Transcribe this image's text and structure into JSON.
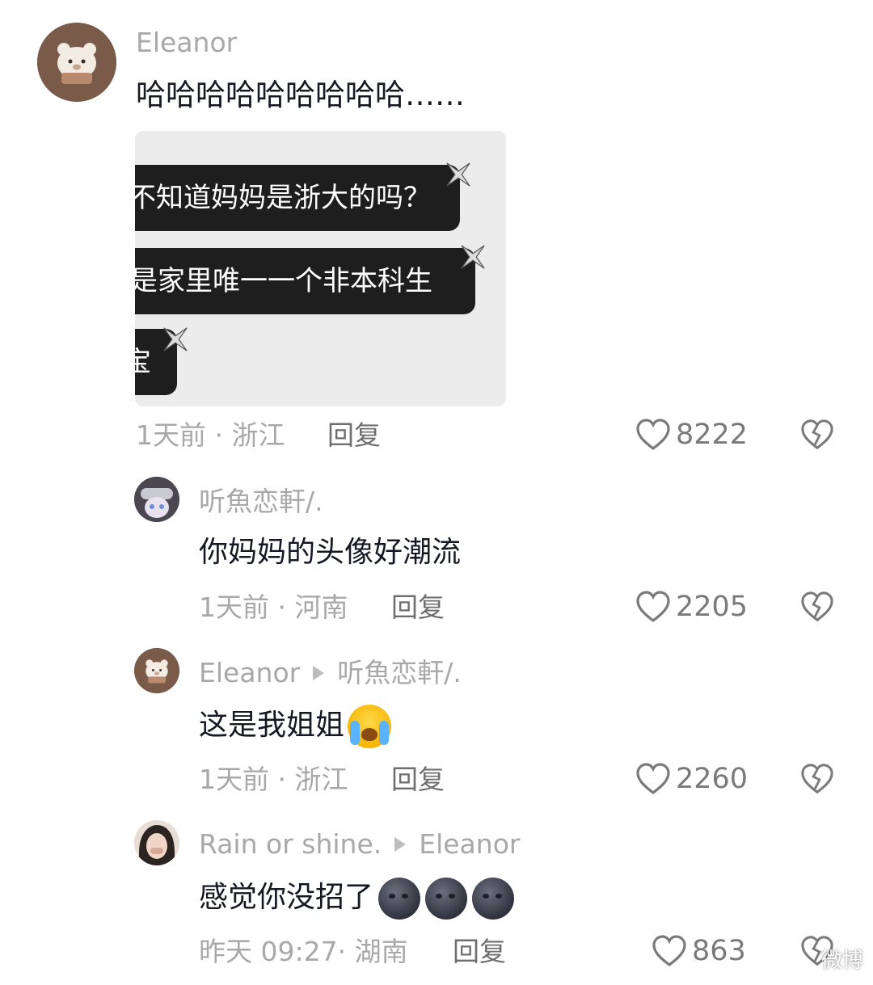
{
  "comments": [
    {
      "username": "Eleanor",
      "text": "哈哈哈哈哈哈哈哈哈……",
      "time": "1天前",
      "location": "浙江",
      "reply_label": "回复",
      "likes": "8222",
      "screenshot": {
        "lines": [
          "不知道妈妈是浙大的吗？",
          "是家里唯一一个非本科生",
          "宝"
        ]
      }
    },
    {
      "username": "听魚恋軒/.",
      "text": "你妈妈的头像好潮流",
      "time": "1天前",
      "location": "河南",
      "reply_label": "回复",
      "likes": "2205"
    },
    {
      "username": "Eleanor",
      "reply_to": "听魚恋軒/.",
      "text": "这是我姐姐",
      "emoji": "loudly-crying-face",
      "time": "1天前",
      "location": "浙江",
      "reply_label": "回复",
      "likes": "2260"
    },
    {
      "username": "Rain or shine.",
      "reply_to": "Eleanor",
      "text": "感觉你没招了",
      "emoji": "new-moon-face ×3",
      "time": "昨天 09:27",
      "location": "湖南",
      "reply_label": "回复",
      "likes": "863"
    }
  ],
  "separator": "·",
  "watermark": "微博",
  "colors": {
    "text": "#161823",
    "muted": "#a8a8a8",
    "bubble": "#1e1e1e"
  }
}
